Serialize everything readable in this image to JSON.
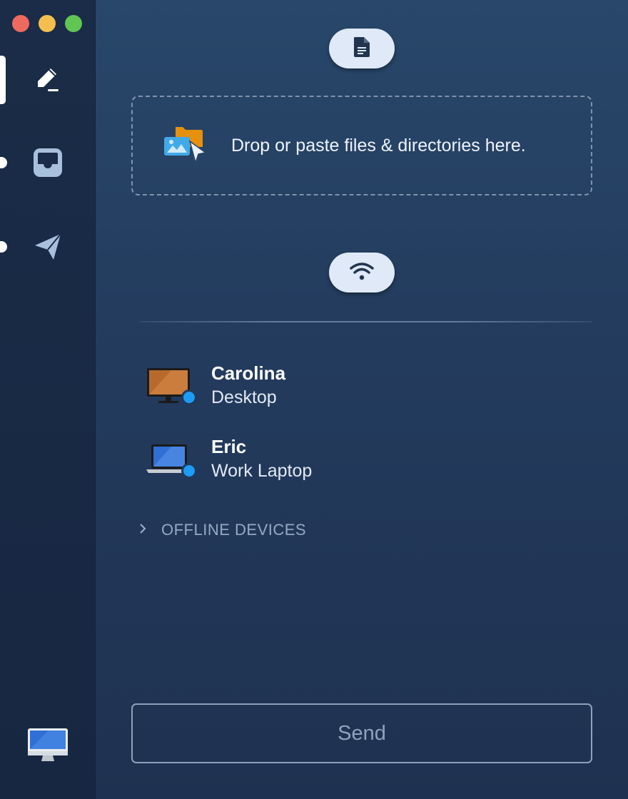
{
  "window": {
    "controls": [
      "close",
      "minimize",
      "maximize"
    ]
  },
  "sidebar": {
    "items": [
      {
        "id": "compose",
        "icon": "pencil-icon",
        "active": true
      },
      {
        "id": "inbox",
        "icon": "inbox-tray-icon",
        "active": false
      },
      {
        "id": "send",
        "icon": "paper-plane-icon",
        "active": false
      }
    ],
    "this_device_icon": "imac-icon"
  },
  "main": {
    "files_button_icon": "document-icon",
    "dropzone": {
      "icon": "files-cursor-icon",
      "text": "Drop or paste files & directories here."
    },
    "network_button_icon": "wifi-icon",
    "devices": [
      {
        "name": "Carolina",
        "type": "Desktop",
        "icon": "desktop-monitor-icon",
        "online": true
      },
      {
        "name": "Eric",
        "type": "Work Laptop",
        "icon": "laptop-icon",
        "online": true
      }
    ],
    "offline_devices_label": "OFFLINE DEVICES",
    "send_label": "Send"
  },
  "colors": {
    "sidebar_bg": "#1a2c47",
    "main_bg": "#28476a",
    "pill_bg": "#dfe9f7",
    "online_dot": "#1e9bf5",
    "close": "#ed6a5e",
    "minimize": "#f4bf4f",
    "maximize": "#61c554"
  }
}
